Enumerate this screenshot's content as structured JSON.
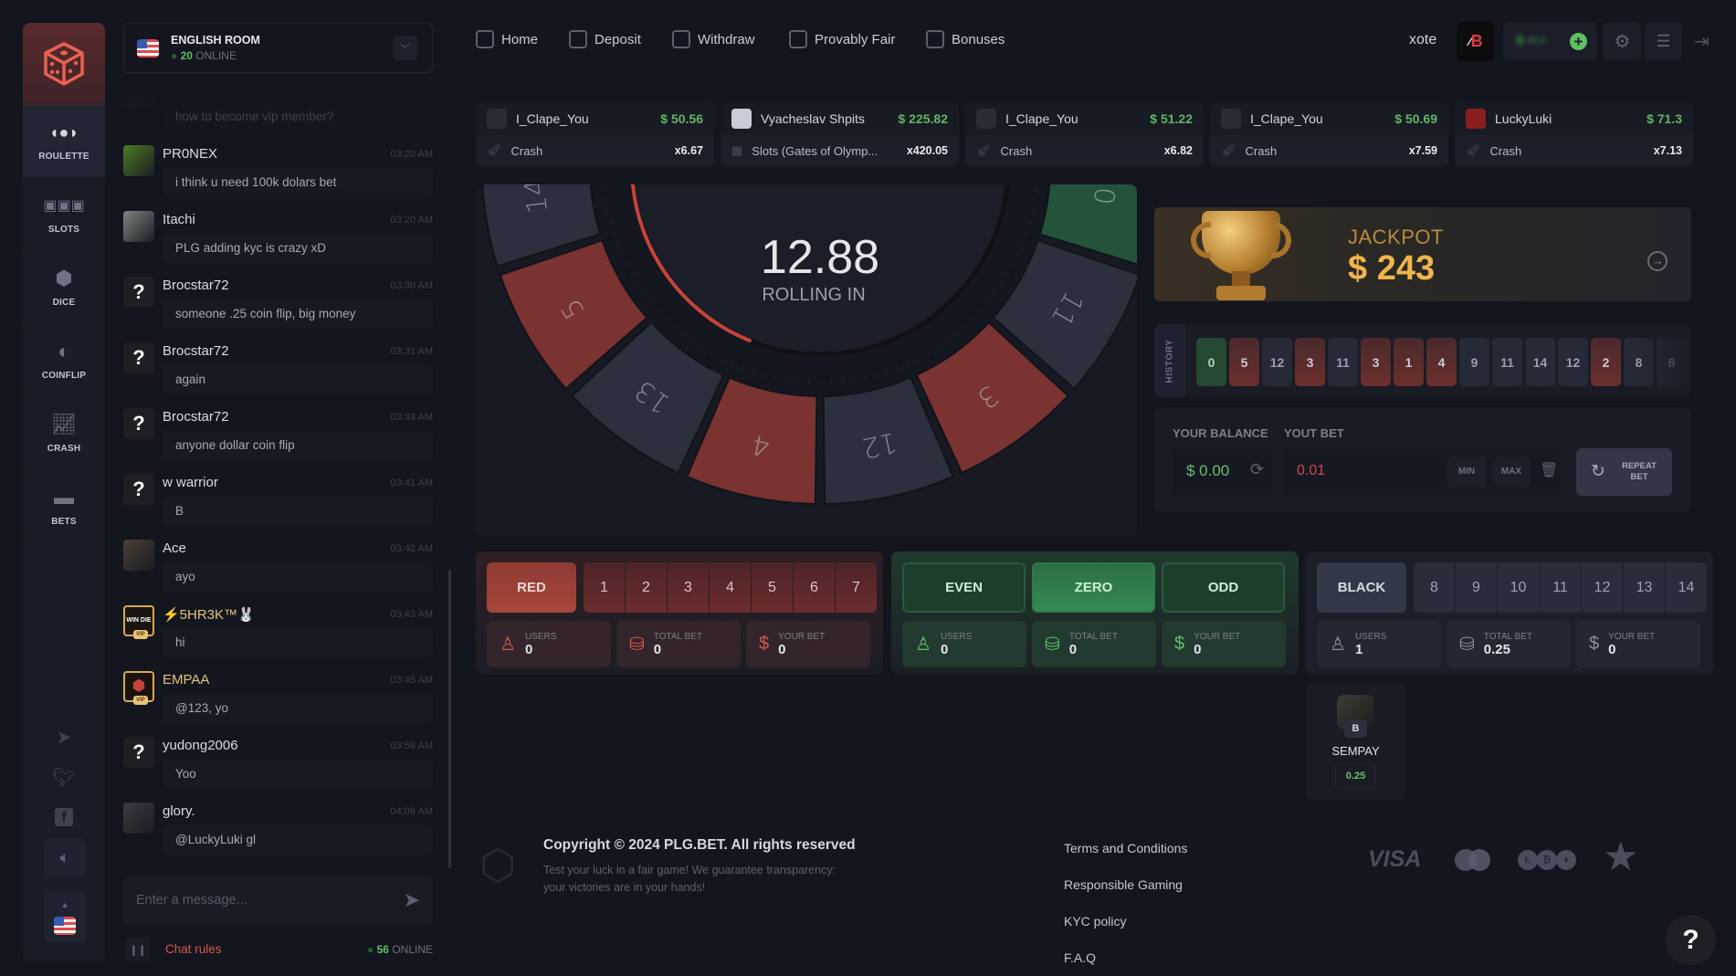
{
  "sidebar": {
    "items": [
      {
        "label": "ROULETTE",
        "icon": "roulette-icon",
        "active": true
      },
      {
        "label": "SLOTS",
        "icon": "slots-icon"
      },
      {
        "label": "DICE",
        "icon": "dice-icon"
      },
      {
        "label": "COINFLIP",
        "icon": "coinflip-icon"
      },
      {
        "label": "CRASH",
        "icon": "crash-icon"
      },
      {
        "label": "BETS",
        "icon": "bets-icon"
      }
    ],
    "social": [
      "telegram-icon",
      "twitter-icon",
      "facebook-icon"
    ]
  },
  "chat": {
    "room": "ENGLISH ROOM",
    "room_online_count": "20",
    "online_label": "ONLINE",
    "messages": [
      {
        "user": "",
        "time": "",
        "text": "how to become vip member?",
        "avatar": "photo",
        "color": "#2a2e38",
        "faded": true
      },
      {
        "user": "PR0NEX",
        "time": "03:20 AM",
        "text": "i think u need 100k dolars bet",
        "avatar": "photo",
        "color": "#4f7a24"
      },
      {
        "user": "Itachi",
        "time": "03:20 AM",
        "text": "PLG adding kyc is crazy xD",
        "avatar": "photo",
        "color": "#7d8480"
      },
      {
        "user": "Brocstar72",
        "time": "03:30 AM",
        "text": "someone .25 coin flip, big money",
        "avatar": "question"
      },
      {
        "user": "Brocstar72",
        "time": "03:31 AM",
        "text": "again",
        "avatar": "question"
      },
      {
        "user": "Brocstar72",
        "time": "03:33 AM",
        "text": "anyone dollar coin flip",
        "avatar": "question"
      },
      {
        "user": "w warrior",
        "time": "03:41 AM",
        "text": "B",
        "avatar": "question"
      },
      {
        "user": "Ace",
        "time": "03:42 AM",
        "text": "ayo",
        "avatar": "photo",
        "color": "#4a3f38"
      },
      {
        "user": "⚡5HR3K™🐰",
        "time": "03:43 AM",
        "text": "hi",
        "avatar": "vip",
        "avatar_text": "WIN DIE",
        "vip": "VIP",
        "gold": true
      },
      {
        "user": "EMPAA",
        "time": "03:45 AM",
        "text": "@123, yo",
        "avatar": "vip",
        "avatar_text": "",
        "vip": "VIP",
        "gold": true
      },
      {
        "user": "yudong2006",
        "time": "03:58 AM",
        "text": "Yoo",
        "avatar": "question"
      },
      {
        "user": "glory.",
        "time": "04:09 AM",
        "text": "@LuckyLuki gl",
        "avatar": "photo",
        "color": "#3a3a40"
      }
    ],
    "input_placeholder": "Enter a message...",
    "rules_label": "Chat rules",
    "footer_online_count": "56",
    "footer_online_label": "ONLINE"
  },
  "topnav": {
    "items": [
      {
        "label": "Home",
        "icon": "home-icon"
      },
      {
        "label": "Deposit",
        "icon": "wallet-icon"
      },
      {
        "label": "Withdraw",
        "icon": "withdraw-icon"
      },
      {
        "label": "Provably Fair",
        "icon": "shield-check-icon"
      },
      {
        "label": "Bonuses",
        "icon": "gift-icon"
      }
    ],
    "username": "xote",
    "balance_blurred": "$ ••.•"
  },
  "live_bets": [
    {
      "user": "I_Clape_You",
      "amount": "$ 50.56",
      "game": "Crash",
      "multiplier": "x6.67"
    },
    {
      "user": "Vyacheslav Shpits",
      "amount": "$ 225.82",
      "game": "Slots (Gates of Olymp...",
      "multiplier": "x420.05"
    },
    {
      "user": "I_Clape_You",
      "amount": "$ 51.22",
      "game": "Crash",
      "multiplier": "x6.82"
    },
    {
      "user": "I_Clape_You",
      "amount": "$ 50.69",
      "game": "Crash",
      "multiplier": "x7.59"
    },
    {
      "user": "LuckyLuki",
      "amount": "$ 71.3",
      "game": "Crash",
      "multiplier": "x7.13"
    }
  ],
  "wheel": {
    "countdown": "12.88",
    "status": "ROLLING IN",
    "segments": [
      {
        "n": "14",
        "color": "black"
      },
      {
        "n": "5",
        "color": "red"
      },
      {
        "n": "13",
        "color": "black"
      },
      {
        "n": "4",
        "color": "red"
      },
      {
        "n": "12",
        "color": "black"
      },
      {
        "n": "3",
        "color": "red"
      },
      {
        "n": "11",
        "color": "black"
      },
      {
        "n": "0",
        "color": "green"
      }
    ],
    "colors": {
      "red": "#7a3330",
      "black": "#2b303c",
      "green": "#23533a",
      "accent": "#c7433a"
    }
  },
  "jackpot": {
    "label": "JACKPOT",
    "amount": "$ 243"
  },
  "history": {
    "label": "HISTORY",
    "results": [
      {
        "n": "0",
        "color": "green"
      },
      {
        "n": "5",
        "color": "red"
      },
      {
        "n": "12",
        "color": "black"
      },
      {
        "n": "3",
        "color": "red"
      },
      {
        "n": "11",
        "color": "black"
      },
      {
        "n": "3",
        "color": "red"
      },
      {
        "n": "1",
        "color": "red"
      },
      {
        "n": "4",
        "color": "red"
      },
      {
        "n": "9",
        "color": "black"
      },
      {
        "n": "11",
        "color": "black"
      },
      {
        "n": "14",
        "color": "black"
      },
      {
        "n": "12",
        "color": "black"
      },
      {
        "n": "2",
        "color": "red"
      },
      {
        "n": "8",
        "color": "black"
      },
      {
        "n": "8",
        "color": "black"
      }
    ]
  },
  "bet_panel": {
    "balance_label": "YOUR BALANCE",
    "bet_label": "YOUT BET",
    "balance": "$ 0.00",
    "bet_value": "0.01",
    "min": "MIN",
    "max": "MAX",
    "repeat": "REPEAT BET"
  },
  "bet_sections": [
    {
      "theme": "red",
      "buttons": [
        {
          "label": "RED",
          "main": true
        }
      ],
      "numbers": [
        "1",
        "2",
        "3",
        "4",
        "5",
        "6",
        "7"
      ],
      "stats": [
        {
          "label": "USERS",
          "value": "0"
        },
        {
          "label": "TOTAL BET",
          "value": "0"
        },
        {
          "label": "YOUR BET",
          "value": "0"
        }
      ]
    },
    {
      "theme": "green",
      "buttons": [
        {
          "label": "EVEN"
        },
        {
          "label": "ZERO",
          "main": true
        },
        {
          "label": "ODD"
        }
      ],
      "numbers": [],
      "stats": [
        {
          "label": "USERS",
          "value": "0"
        },
        {
          "label": "TOTAL BET",
          "value": "0"
        },
        {
          "label": "YOUR BET",
          "value": "0"
        }
      ]
    },
    {
      "theme": "black",
      "buttons": [
        {
          "label": "BLACK",
          "main": true
        }
      ],
      "numbers": [
        "8",
        "9",
        "10",
        "11",
        "12",
        "13",
        "14"
      ],
      "stats": [
        {
          "label": "USERS",
          "value": "1"
        },
        {
          "label": "TOTAL BET",
          "value": "0.25"
        },
        {
          "label": "YOUR BET",
          "value": "0"
        }
      ]
    }
  ],
  "black_bettors": [
    {
      "user": "SEMPAY",
      "badge": "B",
      "amount": "0.25"
    }
  ],
  "footer": {
    "copyright": "Copyright © 2024 PLG.BET. All rights reserved",
    "tagline_1": "Test your luck in a fair game! We guarantee transparency:",
    "tagline_2": "your victories are in your hands!",
    "links": [
      "Terms and Conditions",
      "Responsible Gaming",
      "KYC policy",
      "F.A.Q"
    ],
    "payments": {
      "visa": "VISA",
      "mastercard": "mastercard-icon",
      "crypto": [
        "Ł",
        "₿",
        "♦"
      ],
      "star": "star-icon"
    },
    "help": "?"
  }
}
